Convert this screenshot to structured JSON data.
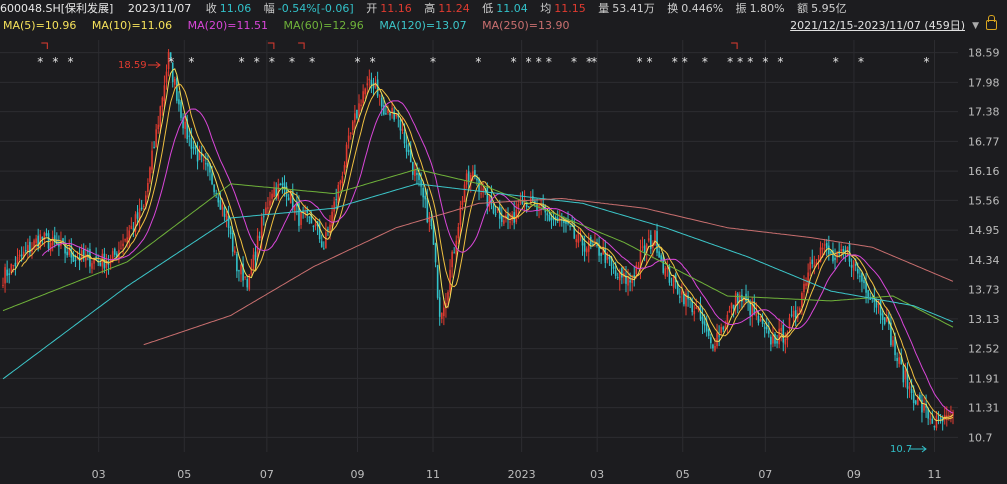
{
  "header": {
    "symbol": "600048.SH[保利发展]",
    "date": "2023/11/07",
    "close_label": "收",
    "close": "11.06",
    "change_label": "幅",
    "change": "-0.54%[-0.06]",
    "open_label": "开",
    "open": "11.16",
    "high_label": "高",
    "high": "11.24",
    "low_label": "低",
    "low": "11.04",
    "avg_label": "均",
    "avg": "11.15",
    "volume_label": "量",
    "volume": "53.41万",
    "turnover_label": "换",
    "turnover": "0.446%",
    "amplitude_label": "振",
    "amplitude": "1.80%",
    "amount_label": "额",
    "amount": "5.95亿"
  },
  "range": {
    "label": "2021/12/15-2023/11/07 (459日)"
  },
  "colors": {
    "up": "#e03b30",
    "down": "#32c1c9",
    "ma5": "#f5e15a",
    "ma10": "#f5e15a",
    "ma20": "#d946d9",
    "ma60": "#6fb23a",
    "ma120": "#3cc6c9",
    "ma250": "#c96f6f",
    "grid": "#2c2c30",
    "axis_text": "#bdbdbd"
  },
  "chart_data": {
    "type": "candlestick",
    "ma_legend": [
      {
        "key": "ma5",
        "name": "MA(5)",
        "value": "10.96"
      },
      {
        "key": "ma10",
        "name": "MA(10)",
        "value": "11.06"
      },
      {
        "key": "ma20",
        "name": "MA(20)",
        "value": "11.51"
      },
      {
        "key": "ma60",
        "name": "MA(60)",
        "value": "12.96"
      },
      {
        "key": "ma120",
        "name": "MA(120)",
        "value": "13.07"
      },
      {
        "key": "ma250",
        "name": "MA(250)",
        "value": "13.90"
      }
    ],
    "y_ticks": [
      "18.59",
      "17.98",
      "17.38",
      "16.77",
      "16.16",
      "15.56",
      "14.95",
      "14.34",
      "13.73",
      "13.13",
      "12.52",
      "11.91",
      "11.31",
      "10.7"
    ],
    "ylim": [
      10.4,
      18.85
    ],
    "x_ticks": [
      "03",
      "05",
      "07",
      "09",
      "11",
      "2023",
      "03",
      "05",
      "07",
      "09",
      "11"
    ],
    "max_label": "18.59",
    "min_label": "10.7",
    "anchors": [
      [
        0,
        14.0
      ],
      [
        18,
        14.8
      ],
      [
        35,
        14.4
      ],
      [
        52,
        14.3
      ],
      [
        62,
        15.0
      ],
      [
        68,
        15.4
      ],
      [
        75,
        17.2
      ],
      [
        80,
        18.5
      ],
      [
        88,
        17.0
      ],
      [
        95,
        16.4
      ],
      [
        102,
        15.9
      ],
      [
        108,
        15.2
      ],
      [
        113,
        14.2
      ],
      [
        119,
        13.9
      ],
      [
        124,
        14.9
      ],
      [
        130,
        15.8
      ],
      [
        137,
        15.8
      ],
      [
        143,
        15.2
      ],
      [
        150,
        15.1
      ],
      [
        155,
        14.6
      ],
      [
        162,
        15.8
      ],
      [
        168,
        16.9
      ],
      [
        174,
        17.8
      ],
      [
        180,
        18.0
      ],
      [
        184,
        17.3
      ],
      [
        190,
        17.4
      ],
      [
        196,
        16.5
      ],
      [
        202,
        15.7
      ],
      [
        207,
        15.0
      ],
      [
        211,
        13.3
      ],
      [
        214,
        13.6
      ],
      [
        218,
        14.6
      ],
      [
        223,
        15.9
      ],
      [
        228,
        16.1
      ],
      [
        233,
        15.6
      ],
      [
        240,
        15.3
      ],
      [
        246,
        15.1
      ],
      [
        250,
        15.7
      ],
      [
        257,
        15.4
      ],
      [
        264,
        15.2
      ],
      [
        270,
        15.1
      ],
      [
        276,
        14.8
      ],
      [
        283,
        14.6
      ],
      [
        290,
        14.5
      ],
      [
        296,
        14.0
      ],
      [
        303,
        13.9
      ],
      [
        309,
        14.5
      ],
      [
        315,
        14.8
      ],
      [
        320,
        14.1
      ],
      [
        327,
        13.7
      ],
      [
        335,
        13.3
      ],
      [
        342,
        12.6
      ],
      [
        348,
        13.0
      ],
      [
        355,
        13.6
      ],
      [
        362,
        13.3
      ],
      [
        370,
        12.7
      ],
      [
        377,
        12.8
      ],
      [
        383,
        13.2
      ],
      [
        390,
        14.3
      ],
      [
        396,
        14.6
      ],
      [
        402,
        14.3
      ],
      [
        408,
        14.5
      ],
      [
        414,
        14.0
      ],
      [
        420,
        13.6
      ],
      [
        426,
        13.2
      ],
      [
        432,
        12.3
      ],
      [
        438,
        11.7
      ],
      [
        444,
        11.3
      ],
      [
        450,
        11.0
      ],
      [
        459,
        11.06
      ]
    ],
    "moving_averages": {
      "ma60": [
        [
          0,
          13.3
        ],
        [
          60,
          14.3
        ],
        [
          110,
          15.9
        ],
        [
          160,
          15.7
        ],
        [
          200,
          16.2
        ],
        [
          230,
          15.9
        ],
        [
          260,
          15.4
        ],
        [
          300,
          14.7
        ],
        [
          350,
          13.6
        ],
        [
          400,
          13.5
        ],
        [
          430,
          13.6
        ],
        [
          459,
          12.96
        ]
      ],
      "ma120": [
        [
          0,
          11.9
        ],
        [
          60,
          13.8
        ],
        [
          110,
          15.2
        ],
        [
          160,
          15.4
        ],
        [
          200,
          15.9
        ],
        [
          240,
          15.7
        ],
        [
          280,
          15.5
        ],
        [
          320,
          15.0
        ],
        [
          360,
          14.4
        ],
        [
          400,
          13.7
        ],
        [
          440,
          13.4
        ],
        [
          459,
          13.07
        ]
      ],
      "ma250": [
        [
          68,
          12.6
        ],
        [
          110,
          13.2
        ],
        [
          150,
          14.2
        ],
        [
          190,
          15.0
        ],
        [
          230,
          15.5
        ],
        [
          270,
          15.6
        ],
        [
          310,
          15.4
        ],
        [
          350,
          15.0
        ],
        [
          390,
          14.8
        ],
        [
          420,
          14.6
        ],
        [
          459,
          13.9
        ]
      ]
    },
    "star_x": [
      0.04,
      0.055,
      0.07,
      0.17,
      0.19,
      0.24,
      0.255,
      0.27,
      0.29,
      0.31,
      0.355,
      0.37,
      0.43,
      0.475,
      0.51,
      0.525,
      0.535,
      0.545,
      0.57,
      0.585,
      0.59,
      0.635,
      0.645,
      0.67,
      0.68,
      0.7,
      0.725,
      0.735,
      0.745,
      0.76,
      0.775,
      0.83,
      0.855,
      0.92
    ]
  }
}
